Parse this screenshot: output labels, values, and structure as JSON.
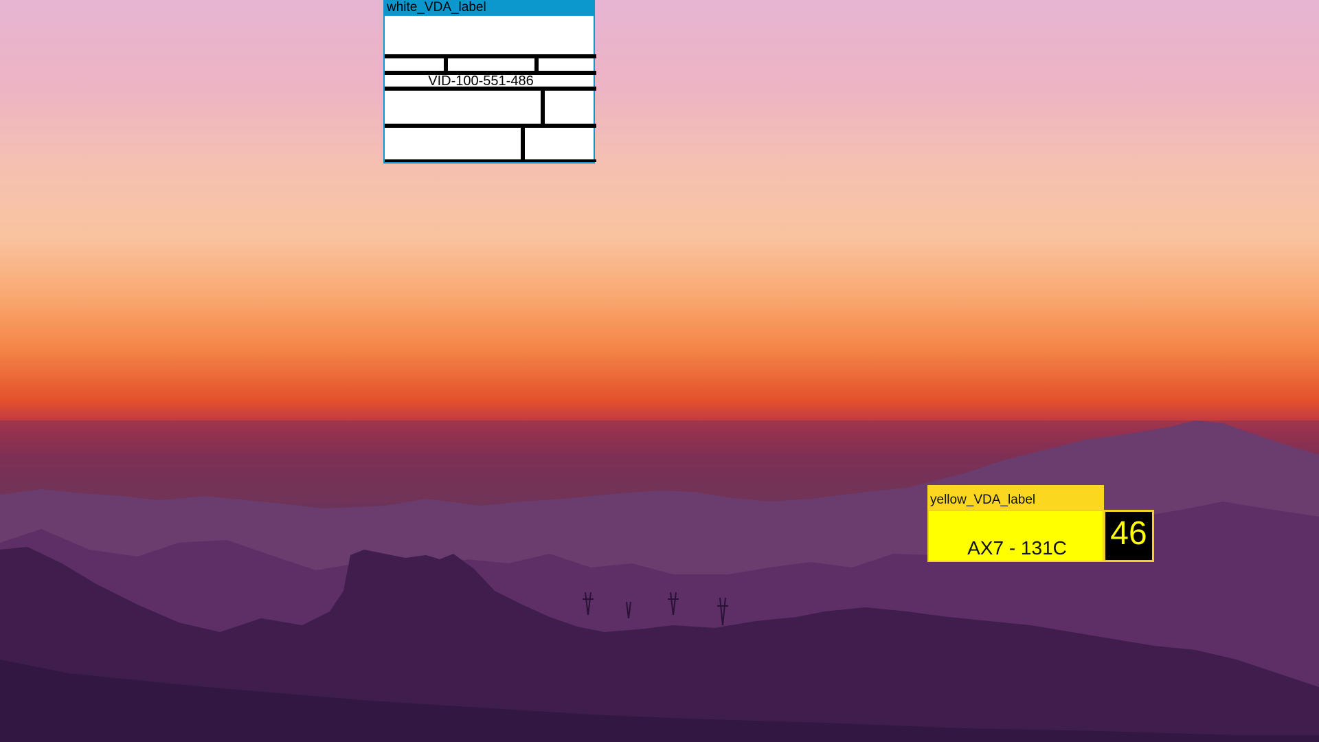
{
  "desktop": {
    "wallpaper": "sunset mountain landscape",
    "colors": {
      "sky_top": "#e6b5d2",
      "sky_horizon": "#f48547",
      "mountains": "#5a2c5c"
    }
  },
  "white_window": {
    "title": "white_VDA_label",
    "id_text": "VID-100-551-486",
    "colors": {
      "titlebar": "#0c97cd",
      "body": "#ffffff",
      "lines": "#000000"
    }
  },
  "yellow_window": {
    "title": "yellow_VDA_label",
    "code": "AX7 - 131C",
    "counter": "46",
    "colors": {
      "titlebar": "#fbd81f",
      "body": "#ffff00",
      "counter_bg": "#000000",
      "counter_text": "#ffff00"
    }
  }
}
